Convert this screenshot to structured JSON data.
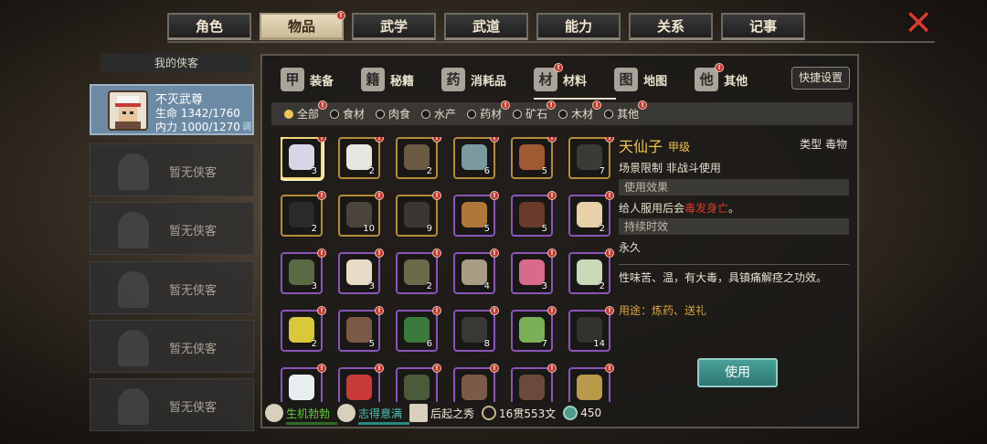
{
  "top_tabs": [
    {
      "label": "角色",
      "active": false,
      "badge": false
    },
    {
      "label": "物品",
      "active": true,
      "badge": true
    },
    {
      "label": "武学",
      "active": false,
      "badge": false
    },
    {
      "label": "武道",
      "active": false,
      "badge": false
    },
    {
      "label": "能力",
      "active": false,
      "badge": false
    },
    {
      "label": "关系",
      "active": false,
      "badge": false
    },
    {
      "label": "记事",
      "active": false,
      "badge": false
    }
  ],
  "left": {
    "title": "我的侠客",
    "hero": {
      "name": "不灭武尊",
      "hp": "生命 1342/1760",
      "mp": "内力 1000/1270",
      "tag": "调"
    },
    "empty_label": "暂无侠客",
    "empty_count": 5
  },
  "sub_tabs": [
    {
      "label": "装备",
      "icon": "armor-icon",
      "glyph": "甲",
      "badge": false,
      "active": false
    },
    {
      "label": "秘籍",
      "icon": "book-icon",
      "glyph": "籍",
      "badge": false,
      "active": false
    },
    {
      "label": "消耗品",
      "icon": "potion-icon",
      "glyph": "药",
      "badge": false,
      "active": false
    },
    {
      "label": "材料",
      "icon": "material-icon",
      "glyph": "材",
      "badge": true,
      "active": true
    },
    {
      "label": "地图",
      "icon": "map-icon",
      "glyph": "图",
      "badge": false,
      "active": false
    },
    {
      "label": "其他",
      "icon": "bell-icon",
      "glyph": "他",
      "badge": true,
      "active": false
    }
  ],
  "quick_settings": "快捷设置",
  "filters": [
    {
      "label": "全部",
      "active": true,
      "badge": true
    },
    {
      "label": "食材",
      "active": false,
      "badge": false
    },
    {
      "label": "肉食",
      "active": false,
      "badge": false
    },
    {
      "label": "水产",
      "active": false,
      "badge": false
    },
    {
      "label": "药材",
      "active": false,
      "badge": true
    },
    {
      "label": "矿石",
      "active": false,
      "badge": true
    },
    {
      "label": "木材",
      "active": false,
      "badge": true
    },
    {
      "label": "其他",
      "active": false,
      "badge": true
    }
  ],
  "items": [
    {
      "qty": "3",
      "color": "#d9d4e6",
      "rarity": "yellow"
    },
    {
      "qty": "2",
      "color": "#e8e6e0",
      "rarity": "yellow"
    },
    {
      "qty": "2",
      "color": "#6b5a44",
      "rarity": "yellow"
    },
    {
      "qty": "6",
      "color": "#7a9a9e",
      "rarity": "yellow"
    },
    {
      "qty": "5",
      "color": "#a05a30",
      "rarity": "yellow"
    },
    {
      "qty": "7",
      "color": "#3a3a36",
      "rarity": "yellow"
    },
    {
      "qty": "2",
      "color": "#2c2a28",
      "rarity": "yellow"
    },
    {
      "qty": "10",
      "color": "#4a443c",
      "rarity": "yellow"
    },
    {
      "qty": "9",
      "color": "#3c3630",
      "rarity": "yellow"
    },
    {
      "qty": "5",
      "color": "#b07838",
      "rarity": "purple"
    },
    {
      "qty": "5",
      "color": "#6a3a2c",
      "rarity": "purple"
    },
    {
      "qty": "2",
      "color": "#e8d0a8",
      "rarity": "purple"
    },
    {
      "qty": "3",
      "color": "#5a6a44",
      "rarity": "purple"
    },
    {
      "qty": "3",
      "color": "#e8dcc8",
      "rarity": "purple"
    },
    {
      "qty": "2",
      "color": "#6a6a4a",
      "rarity": "purple"
    },
    {
      "qty": "4",
      "color": "#a89c84",
      "rarity": "purple"
    },
    {
      "qty": "3",
      "color": "#d86a8a",
      "rarity": "purple"
    },
    {
      "qty": "2",
      "color": "#c8d8b8",
      "rarity": "purple"
    },
    {
      "qty": "2",
      "color": "#d8c83a",
      "rarity": "purple"
    },
    {
      "qty": "5",
      "color": "#7a5a44",
      "rarity": "purple"
    },
    {
      "qty": "6",
      "color": "#3a7a3a",
      "rarity": "purple"
    },
    {
      "qty": "8",
      "color": "#3a3834",
      "rarity": "purple"
    },
    {
      "qty": "7",
      "color": "#7ab05a",
      "rarity": "purple"
    },
    {
      "qty": "14",
      "color": "#34322e",
      "rarity": "purple"
    },
    {
      "qty": "",
      "color": "#e8eef0",
      "rarity": "purple"
    },
    {
      "qty": "",
      "color": "#c83a3a",
      "rarity": "purple"
    },
    {
      "qty": "",
      "color": "#4a5a3a",
      "rarity": "purple"
    },
    {
      "qty": "",
      "color": "#7a5a48",
      "rarity": "purple"
    },
    {
      "qty": "",
      "color": "#6a4a3c",
      "rarity": "purple"
    },
    {
      "qty": "",
      "color": "#b89a4a",
      "rarity": "purple"
    }
  ],
  "detail": {
    "name": "天仙子",
    "grade": "甲级",
    "type": "类型  毒物",
    "scene": "场景限制  非战斗使用",
    "effect_header": "使用效果",
    "effect_prefix": "给人服用后会",
    "effect_red": "毒发身亡",
    "effect_suffix": "。",
    "duration_header": "持续时效",
    "duration": "永久",
    "description": "性味苦、温，有大毒，具镇痛解痉之功效。",
    "usage": "用途：炼药、送礼",
    "use_button": "使用"
  },
  "status": {
    "s1": "生机勃勃",
    "s2": "志得意满",
    "s3": "后起之秀",
    "money": "16贯553文",
    "gems": "450"
  }
}
